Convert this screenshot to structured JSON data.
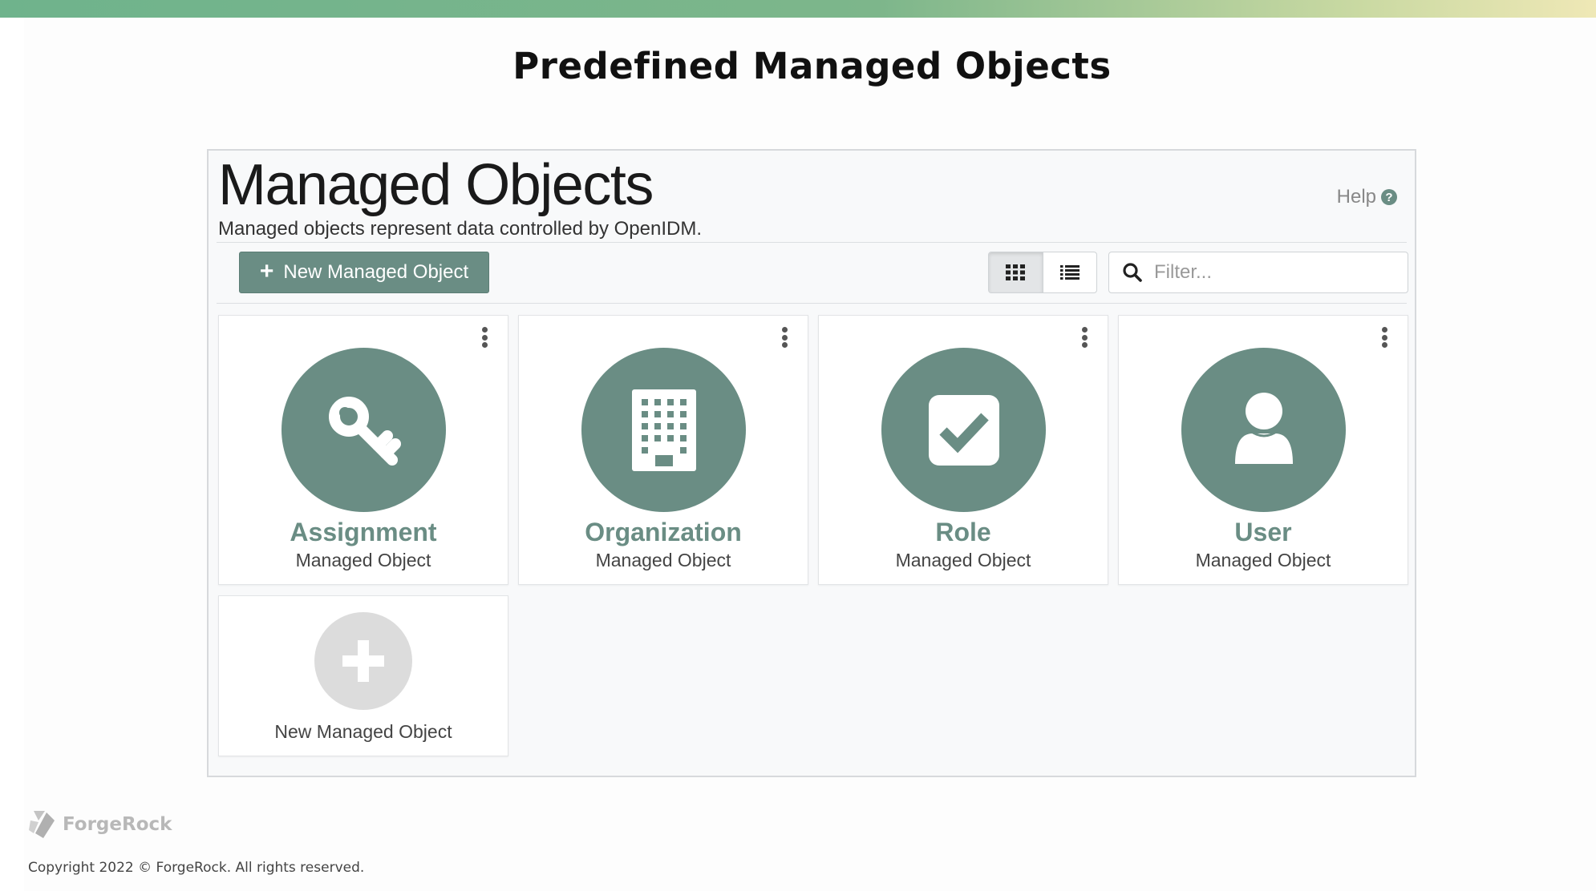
{
  "slide": {
    "title": "Predefined Managed Objects"
  },
  "panel": {
    "title": "Managed Objects",
    "subtitle": "Managed objects represent data controlled by OpenIDM.",
    "help_label": "Help"
  },
  "toolbar": {
    "new_button_label": "New Managed Object",
    "filter_placeholder": "Filter...",
    "filter_value": "",
    "views": [
      "grid",
      "list"
    ],
    "active_view": "grid"
  },
  "cards": [
    {
      "name": "Assignment",
      "type": "Managed Object",
      "icon": "key-icon"
    },
    {
      "name": "Organization",
      "type": "Managed Object",
      "icon": "building-icon"
    },
    {
      "name": "Role",
      "type": "Managed Object",
      "icon": "check-square-icon"
    },
    {
      "name": "User",
      "type": "Managed Object",
      "icon": "user-icon"
    }
  ],
  "add_card": {
    "label": "New Managed Object",
    "icon": "plus-icon"
  },
  "footer": {
    "brand": "ForgeRock",
    "copyright": "Copyright 2022 © ForgeRock.  All rights reserved."
  },
  "colors": {
    "accent": "#6a8d84",
    "top_bar_start": "#6fb38c",
    "top_bar_end": "#efe8b6",
    "placeholder_circle": "#dcdcdc"
  }
}
